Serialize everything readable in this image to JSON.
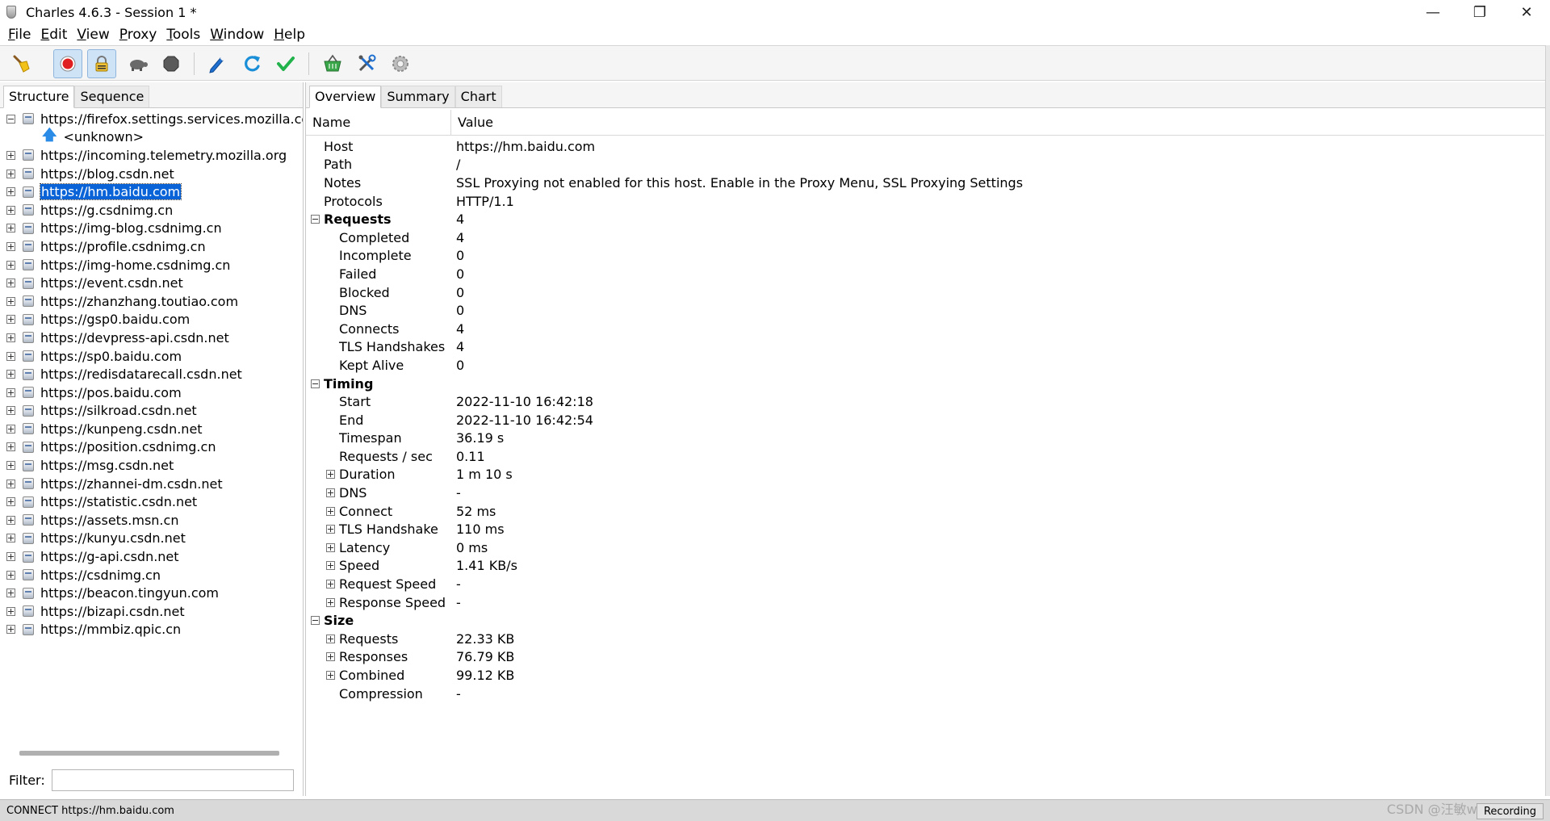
{
  "window": {
    "title": "Charles 4.6.3 - Session 1 *",
    "controls": {
      "minimize": "—",
      "restore": "❐",
      "close": "✕"
    }
  },
  "menu": [
    {
      "mnemonic": "F",
      "rest": "ile"
    },
    {
      "mnemonic": "E",
      "rest": "dit"
    },
    {
      "mnemonic": "V",
      "rest": "iew"
    },
    {
      "mnemonic": "P",
      "rest": "roxy"
    },
    {
      "mnemonic": "T",
      "rest": "ools"
    },
    {
      "mnemonic": "W",
      "rest": "indow"
    },
    {
      "mnemonic": "H",
      "rest": "elp"
    }
  ],
  "toolbar": {
    "icons": [
      "broom-icon",
      "record-icon",
      "ssl-proxying-icon",
      "throttle-turtle-icon",
      "breakpoints-stop-icon",
      "compose-pen-icon",
      "repeat-icon",
      "validate-check-icon",
      "basket-icon",
      "tools-icon",
      "settings-gear-icon"
    ],
    "colors": {
      "record": "#e02020",
      "repeat": "#1a8fd8",
      "check": "#22b24c",
      "basket": "#3aa84a",
      "pen": "#1e6fd0"
    }
  },
  "left_panel": {
    "tabs": [
      "Structure",
      "Sequence"
    ],
    "selected_tab": "Structure",
    "tree": [
      {
        "label": "https://firefox.settings.services.mozilla.com",
        "expanded": true
      },
      {
        "label": "https://incoming.telemetry.mozilla.org",
        "expanded": false
      },
      {
        "label": "https://blog.csdn.net",
        "expanded": false
      },
      {
        "label": "https://hm.baidu.com",
        "expanded": false,
        "selected": true
      },
      {
        "label": "https://g.csdnimg.cn",
        "expanded": false
      },
      {
        "label": "https://img-blog.csdnimg.cn",
        "expanded": false
      },
      {
        "label": "https://profile.csdnimg.cn",
        "expanded": false
      },
      {
        "label": "https://img-home.csdnimg.cn",
        "expanded": false
      },
      {
        "label": "https://event.csdn.net",
        "expanded": false
      },
      {
        "label": "https://zhanzhang.toutiao.com",
        "expanded": false
      },
      {
        "label": "https://gsp0.baidu.com",
        "expanded": false
      },
      {
        "label": "https://devpress-api.csdn.net",
        "expanded": false
      },
      {
        "label": "https://sp0.baidu.com",
        "expanded": false
      },
      {
        "label": "https://redisdatarecall.csdn.net",
        "expanded": false
      },
      {
        "label": "https://pos.baidu.com",
        "expanded": false
      },
      {
        "label": "https://silkroad.csdn.net",
        "expanded": false
      },
      {
        "label": "https://kunpeng.csdn.net",
        "expanded": false
      },
      {
        "label": "https://position.csdnimg.cn",
        "expanded": false
      },
      {
        "label": "https://msg.csdn.net",
        "expanded": false
      },
      {
        "label": "https://zhannei-dm.csdn.net",
        "expanded": false
      },
      {
        "label": "https://statistic.csdn.net",
        "expanded": false
      },
      {
        "label": "https://assets.msn.cn",
        "expanded": false
      },
      {
        "label": "https://kunyu.csdn.net",
        "expanded": false
      },
      {
        "label": "https://g-api.csdn.net",
        "expanded": false
      },
      {
        "label": "https://csdnimg.cn",
        "expanded": false
      },
      {
        "label": "https://beacon.tingyun.com",
        "expanded": false
      },
      {
        "label": "https://bizapi.csdn.net",
        "expanded": false
      },
      {
        "label": "https://mmbiz.qpic.cn",
        "expanded": false
      }
    ],
    "unknown_child": "<unknown>",
    "filter_label": "Filter:",
    "filter_value": ""
  },
  "right_panel": {
    "tabs": [
      "Overview",
      "Summary",
      "Chart"
    ],
    "selected_tab": "Overview",
    "columns": {
      "name": "Name",
      "value": "Value"
    },
    "rows": [
      {
        "name": "Host",
        "value": "https://hm.baidu.com",
        "level": 0,
        "toggle": "none"
      },
      {
        "name": "Path",
        "value": "/",
        "level": 0,
        "toggle": "none"
      },
      {
        "name": "Notes",
        "value": "SSL Proxying not enabled for this host. Enable in the Proxy Menu, SSL Proxying Settings",
        "level": 0,
        "toggle": "none"
      },
      {
        "name": "Protocols",
        "value": "HTTP/1.1",
        "level": 0,
        "toggle": "none"
      },
      {
        "name": "Requests",
        "value": "4",
        "level": 0,
        "toggle": "minus",
        "bold": true
      },
      {
        "name": "Completed",
        "value": "4",
        "level": 1,
        "toggle": "none"
      },
      {
        "name": "Incomplete",
        "value": "0",
        "level": 1,
        "toggle": "none"
      },
      {
        "name": "Failed",
        "value": "0",
        "level": 1,
        "toggle": "none"
      },
      {
        "name": "Blocked",
        "value": "0",
        "level": 1,
        "toggle": "none"
      },
      {
        "name": "DNS",
        "value": "0",
        "level": 1,
        "toggle": "none"
      },
      {
        "name": "Connects",
        "value": "4",
        "level": 1,
        "toggle": "none"
      },
      {
        "name": "TLS Handshakes",
        "value": "4",
        "level": 1,
        "toggle": "none"
      },
      {
        "name": "Kept Alive",
        "value": "0",
        "level": 1,
        "toggle": "none"
      },
      {
        "name": "Timing",
        "value": "",
        "level": 0,
        "toggle": "minus",
        "bold": true
      },
      {
        "name": "Start",
        "value": "2022-11-10 16:42:18",
        "level": 1,
        "toggle": "none"
      },
      {
        "name": "End",
        "value": "2022-11-10 16:42:54",
        "level": 1,
        "toggle": "none"
      },
      {
        "name": "Timespan",
        "value": "36.19 s",
        "level": 1,
        "toggle": "none"
      },
      {
        "name": "Requests / sec",
        "value": "0.11",
        "level": 1,
        "toggle": "none"
      },
      {
        "name": "Duration",
        "value": "1 m 10 s",
        "level": 1,
        "toggle": "plus"
      },
      {
        "name": "DNS",
        "value": "-",
        "level": 1,
        "toggle": "plus"
      },
      {
        "name": "Connect",
        "value": "52 ms",
        "level": 1,
        "toggle": "plus"
      },
      {
        "name": "TLS Handshake",
        "value": "110 ms",
        "level": 1,
        "toggle": "plus"
      },
      {
        "name": "Latency",
        "value": "0 ms",
        "level": 1,
        "toggle": "plus"
      },
      {
        "name": "Speed",
        "value": "1.41 KB/s",
        "level": 1,
        "toggle": "plus"
      },
      {
        "name": "Request Speed",
        "value": "-",
        "level": 1,
        "toggle": "plus"
      },
      {
        "name": "Response Speed",
        "value": "-",
        "level": 1,
        "toggle": "plus"
      },
      {
        "name": "Size",
        "value": "",
        "level": 0,
        "toggle": "minus",
        "bold": true
      },
      {
        "name": "Requests",
        "value": "22.33 KB",
        "level": 1,
        "toggle": "plus"
      },
      {
        "name": "Responses",
        "value": "76.79 KB",
        "level": 1,
        "toggle": "plus"
      },
      {
        "name": "Combined",
        "value": "99.12 KB",
        "level": 1,
        "toggle": "plus"
      },
      {
        "name": "Compression",
        "value": "-",
        "level": 1,
        "toggle": "none"
      }
    ]
  },
  "status": {
    "text": "CONNECT https://hm.baidu.com",
    "recording": "Recording",
    "watermark": "CSDN @汪敏wangmin"
  }
}
